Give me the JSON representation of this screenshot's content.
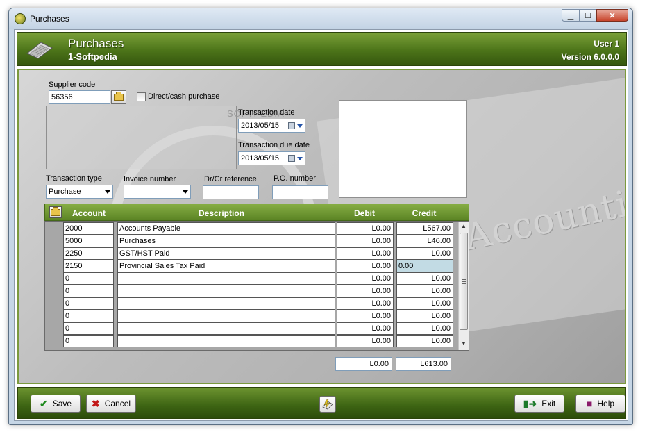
{
  "window": {
    "title": "Purchases",
    "min_symbol": "▁",
    "max_symbol": "☐",
    "close_symbol": "✕"
  },
  "header": {
    "title": "Purchases",
    "company": "1-Softpedia",
    "user": "User 1",
    "version": "Version 6.0.0.0"
  },
  "form": {
    "supplier_code_label": "Supplier code",
    "supplier_code_value": "56356",
    "direct_purchase_label": "Direct/cash purchase",
    "direct_purchase_checked": false,
    "transaction_date_label": "Transaction date",
    "transaction_date_value": "2013/05/15",
    "due_date_label": "Transaction due date",
    "due_date_value": "2013/05/15",
    "transaction_type_label": "Transaction type",
    "transaction_type_value": "Purchase",
    "invoice_number_label": "Invoice number",
    "invoice_number_value": "",
    "drcr_reference_label": "Dr/Cr reference",
    "drcr_reference_value": "",
    "po_number_label": "P.O. number",
    "po_number_value": "",
    "watermark": "SOFTPEDIA",
    "background_text": "Accounting"
  },
  "grid": {
    "columns": [
      "Account",
      "Description",
      "Debit",
      "Credit"
    ],
    "rows": [
      {
        "account": "2000",
        "description": "Accounts Payable",
        "debit": "L0.00",
        "credit": "L567.00"
      },
      {
        "account": "5000",
        "description": "Purchases",
        "debit": "L0.00",
        "credit": "L46.00"
      },
      {
        "account": "2250",
        "description": "GST/HST Paid",
        "debit": "L0.00",
        "credit": "L0.00"
      },
      {
        "account": "2150",
        "description": "Provincial Sales Tax Paid",
        "debit": "L0.00",
        "credit": "0.00"
      },
      {
        "account": "0",
        "description": "",
        "debit": "L0.00",
        "credit": "L0.00"
      },
      {
        "account": "0",
        "description": "",
        "debit": "L0.00",
        "credit": "L0.00"
      },
      {
        "account": "0",
        "description": "",
        "debit": "L0.00",
        "credit": "L0.00"
      },
      {
        "account": "0",
        "description": "",
        "debit": "L0.00",
        "credit": "L0.00"
      },
      {
        "account": "0",
        "description": "",
        "debit": "L0.00",
        "credit": "L0.00"
      },
      {
        "account": "0",
        "description": "",
        "debit": "L0.00",
        "credit": "L0.00"
      }
    ],
    "editing_row": 3,
    "total_debit": "L0.00",
    "total_credit": "L613.00"
  },
  "footer": {
    "save_label": "Save",
    "cancel_label": "Cancel",
    "exit_label": "Exit",
    "help_label": "Help"
  },
  "icons": {
    "save": "checkmark-icon",
    "cancel": "cross-icon",
    "exit": "exit-door-icon",
    "help": "help-book-icon",
    "tool": "calculator-icon",
    "lookup": "folder-lookup-icon"
  },
  "colors": {
    "header_green": "#4c7419",
    "grid_header_green": "#6f9a32",
    "editing_cell": "#c2dbe4"
  }
}
